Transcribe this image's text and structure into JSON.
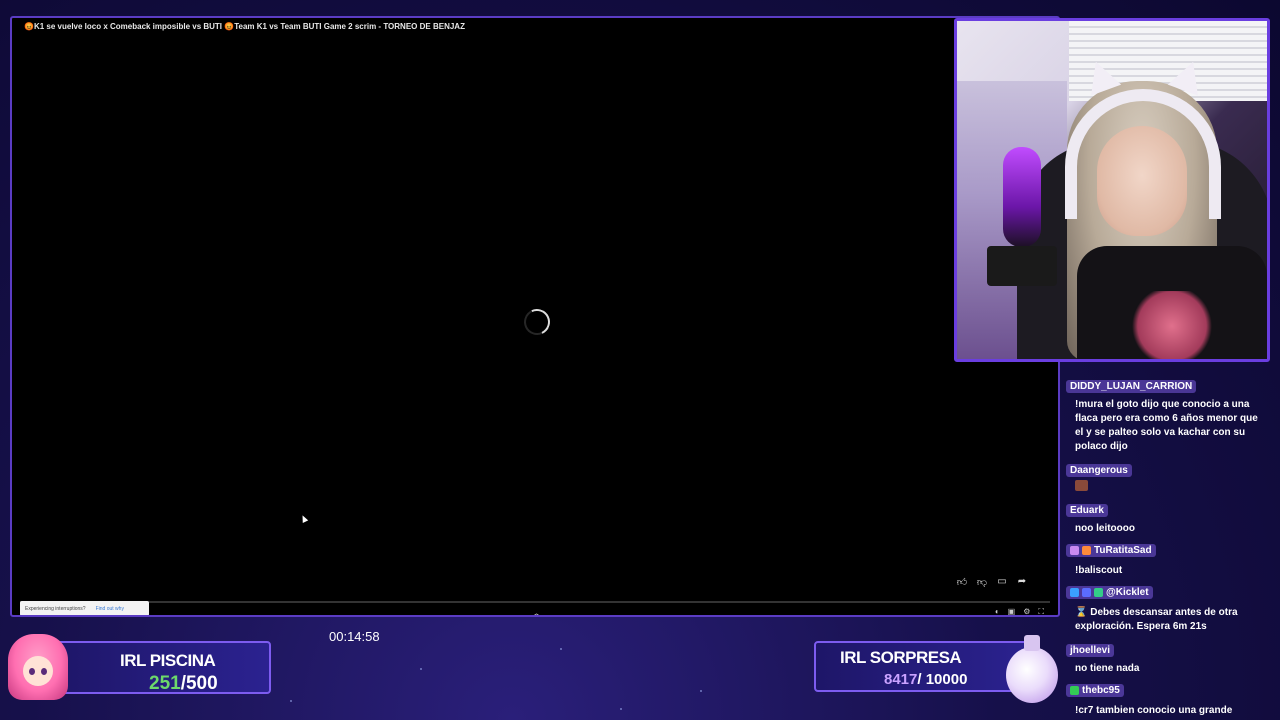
{
  "video": {
    "title": "😡K1 se vuelve loco x Comeback imposible vs BUTI 😡Team K1 vs Team BUTI Game 2 scrim - TORNEO DE BENJAZ",
    "interruption_text": "Experiencing interruptions?",
    "interruption_link": "Find out why",
    "actions": [
      "like-icon",
      "dislike-icon",
      "comment-icon",
      "share-icon"
    ]
  },
  "chat": {
    "messages": [
      {
        "user": "DIDDY_LUJAN_CARRION",
        "text": "!mura el goto dijo que conocio a una flaca pero era como 6 años menor que el y se palteo solo va kachar con su polaco dijo",
        "badges": []
      },
      {
        "user": "Daangerous",
        "text": "",
        "emote": true,
        "badges": []
      },
      {
        "user": "Eduark",
        "text": "noo leitoooo",
        "badges": []
      },
      {
        "user": "TuRatitaSad",
        "text": "!baliscout",
        "badges": [
          "#c98af0",
          "#ff8a3a"
        ]
      },
      {
        "user": "@Kicklet",
        "text": "⌛ Debes descansar antes de otra exploración. Espera 6m 21s",
        "badges": [
          "#3aa0ff",
          "#5b6cff",
          "#33cc88"
        ]
      },
      {
        "user": "jhoellevi",
        "text": "no tiene nada",
        "badges": []
      },
      {
        "user": "thebc95",
        "text": "!cr7 tambien conocio una grande",
        "badges": [
          "#33cc55"
        ]
      }
    ]
  },
  "overlay": {
    "timer": "00:14:58",
    "goal_left": {
      "title": "IRL PISCINA",
      "current": "251",
      "sep_total": "/500"
    },
    "goal_right": {
      "title": "IRL SORPRESA",
      "current": "8417",
      "sep_total": "/ 10000"
    }
  },
  "colors": {
    "frame": "#5b3cc4",
    "goal_green": "#6dd86b",
    "goal_purple": "#c9a2ff"
  }
}
